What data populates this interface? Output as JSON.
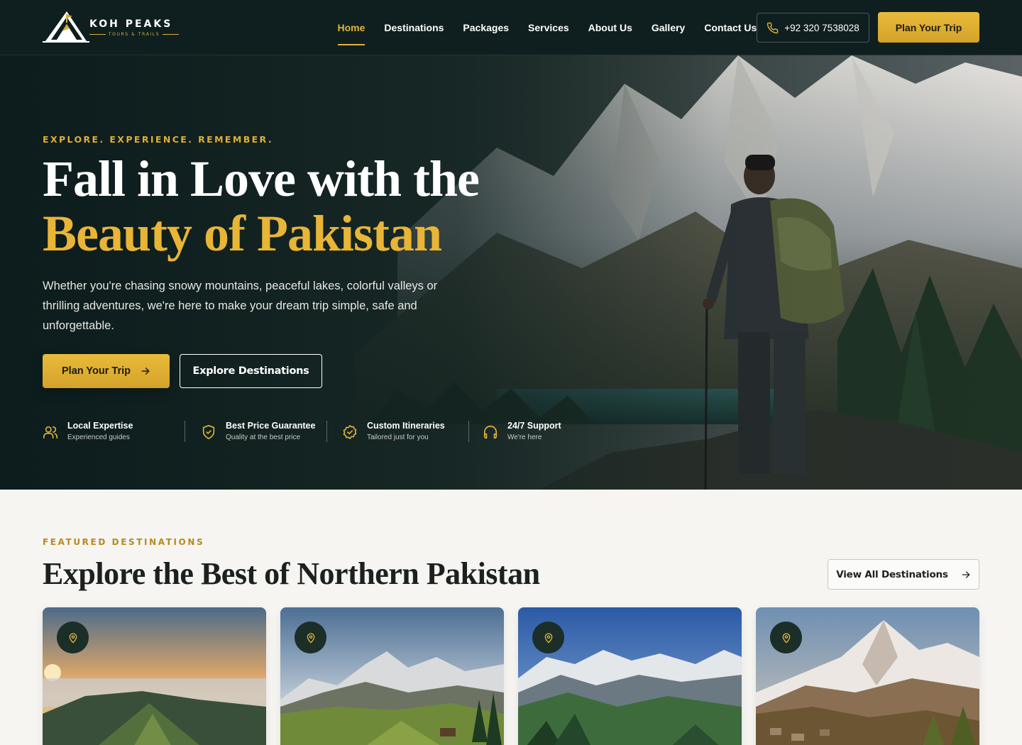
{
  "brand": {
    "name": "KOH PEAKS",
    "tagline": "TOURS & TRAILS"
  },
  "nav": {
    "items": [
      {
        "label": "Home",
        "active": true
      },
      {
        "label": "Destinations",
        "active": false
      },
      {
        "label": "Packages",
        "active": false
      },
      {
        "label": "Services",
        "active": false
      },
      {
        "label": "About Us",
        "active": false
      },
      {
        "label": "Gallery",
        "active": false
      },
      {
        "label": "Contact Us",
        "active": false
      }
    ],
    "phone": "+92 320 7538028",
    "cta": "Plan Your Trip"
  },
  "hero": {
    "eyebrow": "EXPLORE. EXPERIENCE. REMEMBER.",
    "title_line1": "Fall in Love with the",
    "title_line2": "Beauty of Pakistan",
    "description": "Whether you're chasing snowy mountains, peaceful lakes, colorful valleys or thrilling adventures, we're here to make your dream trip simple, safe and unforgettable.",
    "primary_button": "Plan Your Trip",
    "secondary_button": "Explore Destinations",
    "features": [
      {
        "title": "Local Expertise",
        "subtitle": "Experienced guides",
        "icon": "users-icon"
      },
      {
        "title": "Best Price Guarantee",
        "subtitle": "Quality at the best price",
        "icon": "shield-check-icon"
      },
      {
        "title": "Custom Itineraries",
        "subtitle": "Tailored just for you",
        "icon": "badge-check-icon"
      },
      {
        "title": "24/7 Support",
        "subtitle": "We're here",
        "icon": "headset-icon"
      }
    ]
  },
  "featured": {
    "eyebrow": "FEATURED DESTINATIONS",
    "title": "Explore the Best of Northern Pakistan",
    "view_all": "View All Destinations",
    "cards": [
      {
        "icon": "map-pin-icon"
      },
      {
        "icon": "map-pin-icon"
      },
      {
        "icon": "map-pin-icon"
      },
      {
        "icon": "map-pin-icon"
      }
    ]
  },
  "colors": {
    "accent": "#e2b33a",
    "header_bg": "#0f1f20",
    "page_bg": "#f6f5f1",
    "pin_bg": "#1c2e28"
  }
}
